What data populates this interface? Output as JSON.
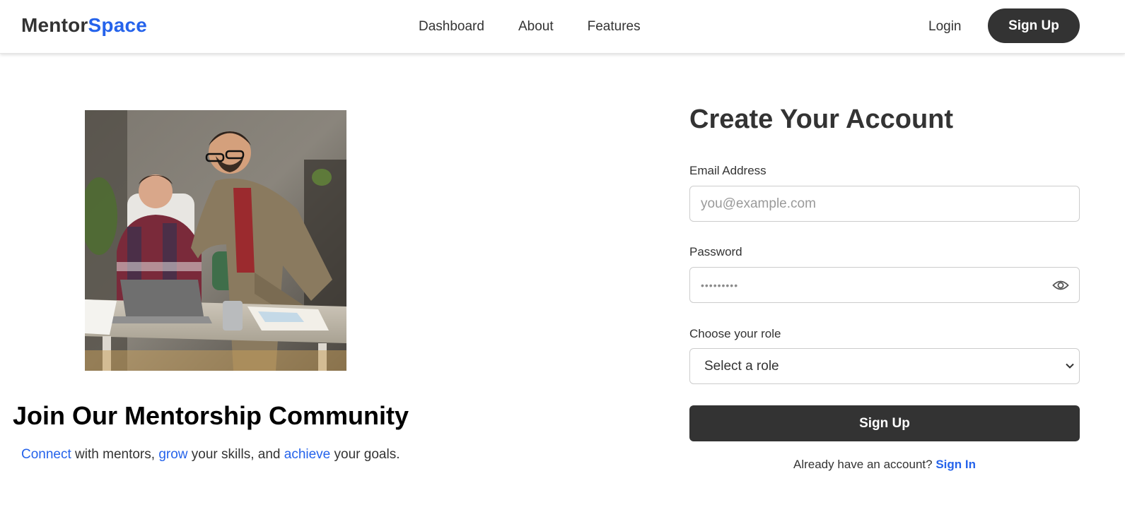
{
  "header": {
    "logo_part1": "Mentor",
    "logo_part2": "Space",
    "nav": [
      "Dashboard",
      "About",
      "Features"
    ],
    "login_label": "Login",
    "signup_label": "Sign Up"
  },
  "hero": {
    "title": "Join Our Mentorship Community",
    "subtitle": {
      "word1": "Connect",
      "text1": " with mentors, ",
      "word2": "grow",
      "text2": " your skills, and ",
      "word3": "achieve",
      "text3": " your goals."
    }
  },
  "form": {
    "title": "Create Your Account",
    "email_label": "Email Address",
    "email_placeholder": "you@example.com",
    "password_label": "Password",
    "password_value": "•••••••••",
    "role_label": "Choose your role",
    "role_selected": "Select a role",
    "submit_label": "Sign Up",
    "already_text": "Already have an account?",
    "signin_label": "Sign In"
  },
  "colors": {
    "accent": "#2563eb",
    "dark": "#333333"
  },
  "icons": {
    "password_toggle": "eye-icon",
    "select_arrow": "chevron-down-icon"
  }
}
